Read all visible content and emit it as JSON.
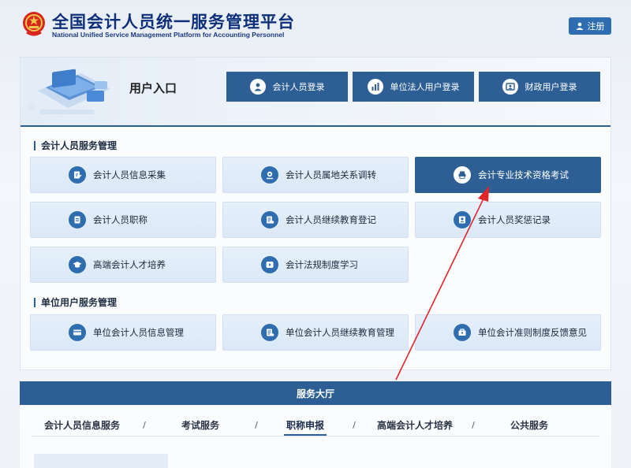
{
  "header": {
    "title": "全国会计人员统一服务管理平台",
    "subtitle": "National Unified Service Management Platform for Accounting Personnel",
    "register_label": "注册"
  },
  "entry": {
    "title": "用户入口",
    "buttons": [
      {
        "label": "会计人员登录",
        "icon": "person-icon"
      },
      {
        "label": "单位法人用户登录",
        "icon": "building-icon"
      },
      {
        "label": "财政用户登录",
        "icon": "id-card-icon"
      }
    ]
  },
  "personnel_section": {
    "title": "会计人员服务管理",
    "items": [
      {
        "label": "会计人员信息采集",
        "icon": "edit-form-icon"
      },
      {
        "label": "会计人员属地关系调转",
        "icon": "location-icon"
      },
      {
        "label": "会计专业技术资格考试",
        "icon": "printer-icon",
        "active": true
      },
      {
        "label": "会计人员职称",
        "icon": "document-icon"
      },
      {
        "label": "会计人员继续教育登记",
        "icon": "register-icon"
      },
      {
        "label": "会计人员奖惩记录",
        "icon": "record-icon"
      },
      {
        "label": "高端会计人才培养",
        "icon": "graduation-cap-icon"
      },
      {
        "label": "会计法规制度学习",
        "icon": "play-icon"
      }
    ]
  },
  "unit_section": {
    "title": "单位用户服务管理",
    "items": [
      {
        "label": "单位会计人员信息管理",
        "icon": "card-icon"
      },
      {
        "label": "单位会计人员继续教育管理",
        "icon": "register-icon"
      },
      {
        "label": "单位会计准则制度反馈意见",
        "icon": "feedback-icon"
      }
    ]
  },
  "hall": {
    "title": "服务大厅",
    "tabs": [
      {
        "label": "会计人员信息服务"
      },
      {
        "label": "考试服务"
      },
      {
        "label": "职称申报",
        "active": true
      },
      {
        "label": "高端会计人才培养"
      },
      {
        "label": "公共服务"
      }
    ],
    "separator": "/"
  },
  "colors": {
    "primary": "#2d5f95",
    "title_blue": "#0e2f7a",
    "tile_bg": "#e3edf8",
    "annotation_red": "#e0242a"
  }
}
